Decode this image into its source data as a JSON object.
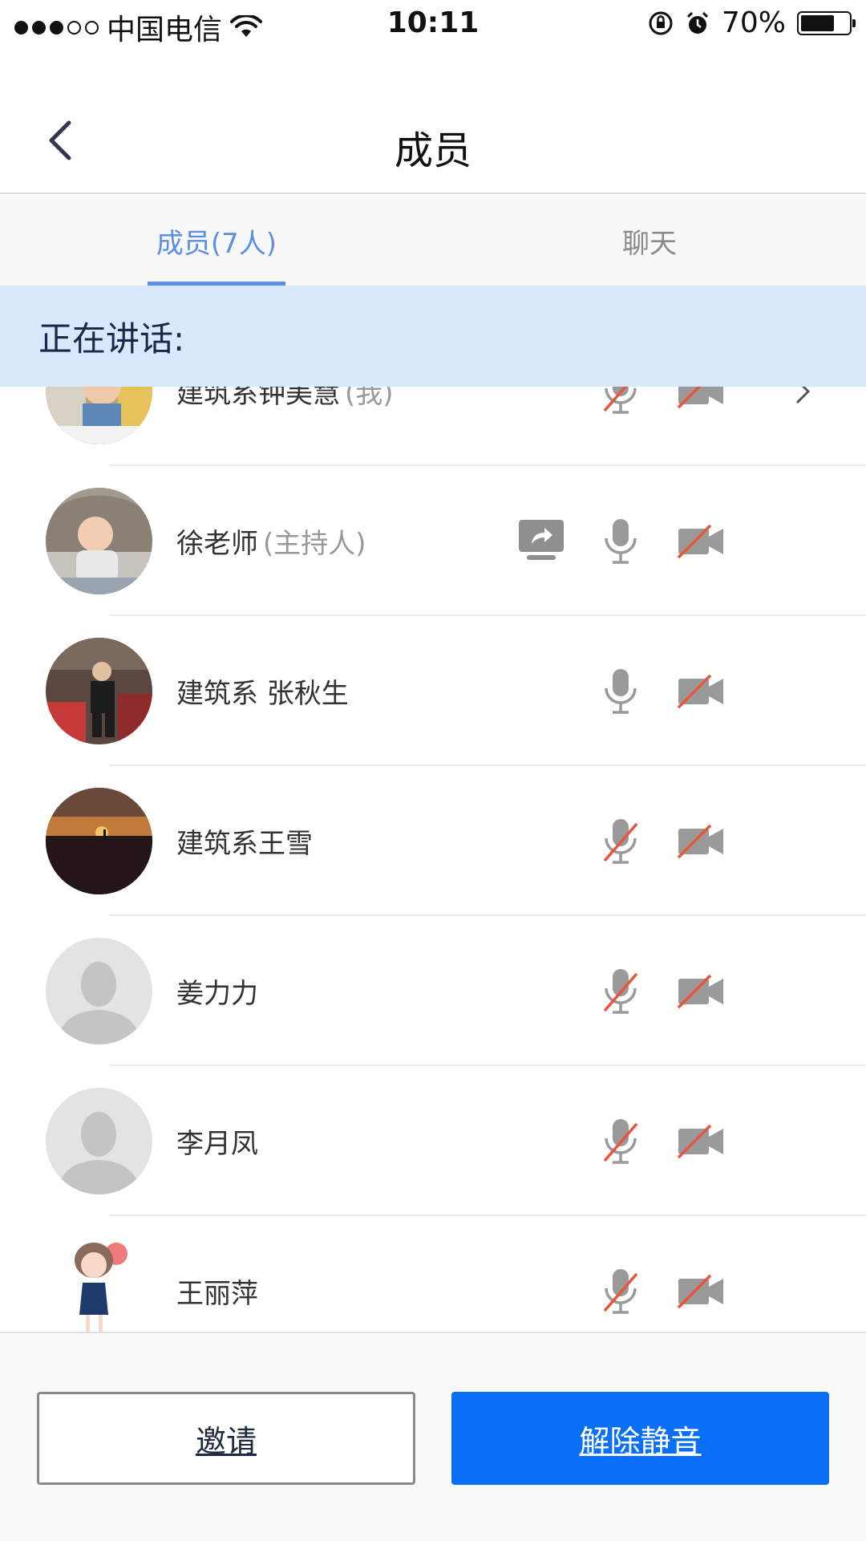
{
  "status_bar": {
    "carrier": "中国电信",
    "time": "10:11",
    "battery_percent": "70%",
    "battery_level": 0.7,
    "signal_bars_filled": 3,
    "signal_bars_total": 5
  },
  "nav": {
    "title": "成员",
    "back_icon": "chevron-left-icon"
  },
  "tabs": [
    {
      "label": "成员(7人)",
      "active": true
    },
    {
      "label": "聊天",
      "active": false
    }
  ],
  "speaking_label": "正在讲话:",
  "members": [
    {
      "name": "建筑系钟美慧",
      "role": "(我)",
      "avatar": "photo-baby",
      "sharing": false,
      "mic": "muted",
      "camera": "off",
      "chevron": true
    },
    {
      "name": "徐老师",
      "role": "(主持人)",
      "avatar": "photo-baby-laughing",
      "sharing": true,
      "mic": "on",
      "camera": "off",
      "chevron": false
    },
    {
      "name": "建筑系 张秋生",
      "role": "",
      "avatar": "photo-man-sitting",
      "sharing": false,
      "mic": "on",
      "camera": "off",
      "chevron": false
    },
    {
      "name": "建筑系王雪",
      "role": "",
      "avatar": "photo-sunset",
      "sharing": false,
      "mic": "muted",
      "camera": "off",
      "chevron": false
    },
    {
      "name": "姜力力",
      "role": "",
      "avatar": "default-avatar",
      "sharing": false,
      "mic": "muted",
      "camera": "off",
      "chevron": false
    },
    {
      "name": "李月凤",
      "role": "",
      "avatar": "default-avatar",
      "sharing": false,
      "mic": "muted",
      "camera": "off",
      "chevron": false
    },
    {
      "name": "王丽萍",
      "role": "",
      "avatar": "cartoon-girl",
      "sharing": false,
      "mic": "muted",
      "camera": "off",
      "chevron": false
    }
  ],
  "buttons": {
    "invite": "邀请",
    "unmute": "解除静音"
  },
  "colors": {
    "accent": "#5b8ee6",
    "primary_button": "#0a6ff7",
    "speaking_bg": "#d9e8fb",
    "muted_slash": "#e8553e",
    "icon_gray": "#9a9a9a"
  }
}
